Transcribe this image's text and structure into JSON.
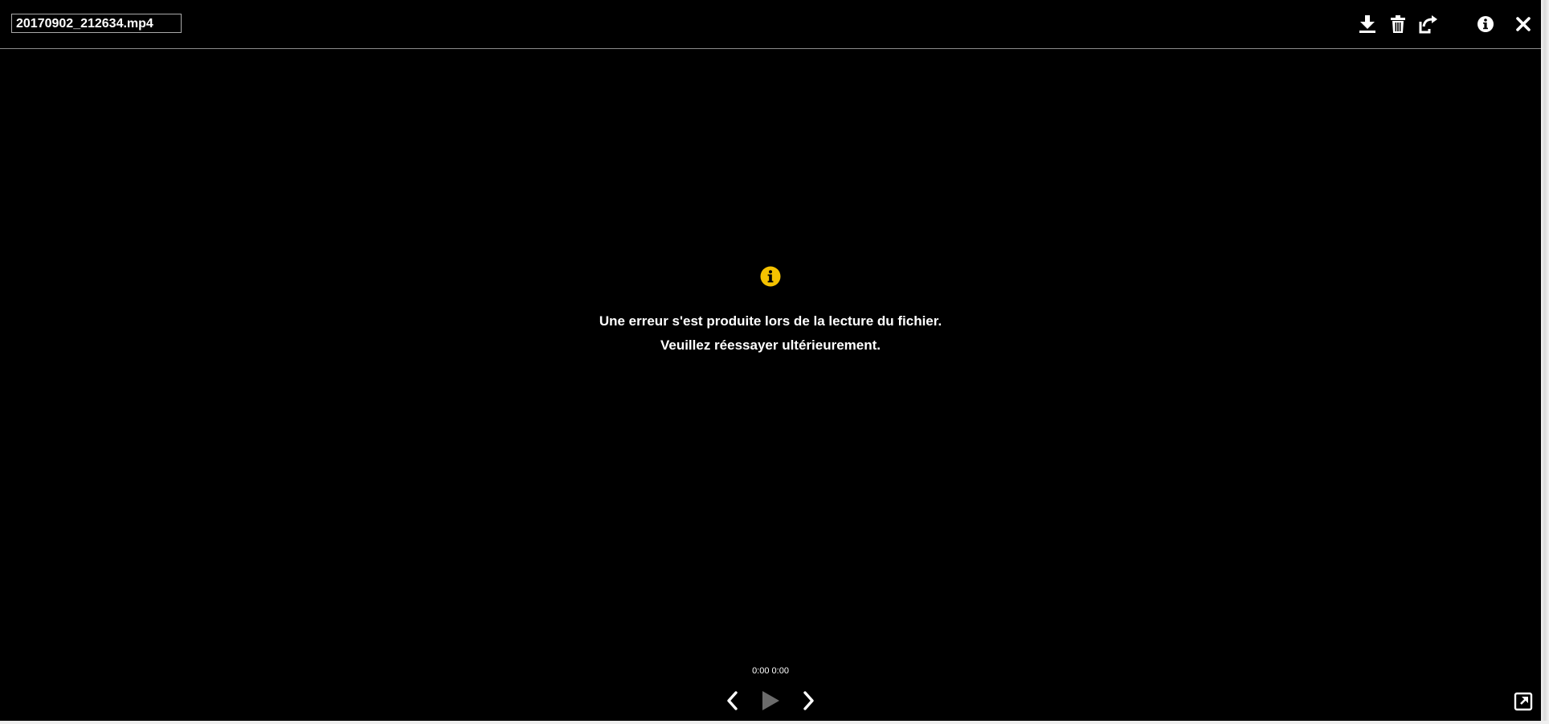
{
  "header": {
    "filename": "20170902_212634.mp4",
    "toolbar": {
      "download_icon": "download-icon",
      "delete_icon": "trash-icon",
      "share_icon": "share-icon",
      "info_icon": "info-icon",
      "close_icon": "close-icon"
    }
  },
  "message": {
    "icon": "info-circle-icon",
    "line1": "Une erreur s'est produite lors de la lecture du fichier.",
    "line2": "Veuillez réessayer ultérieurement."
  },
  "player": {
    "time": "0:00 0:00",
    "prev_icon": "chevron-left-icon",
    "play_icon": "play-icon",
    "next_icon": "chevron-right-icon",
    "popout_icon": "external-window-icon"
  },
  "colors": {
    "background": "#000000",
    "text": "#ffffff",
    "accent": "#f5c200",
    "disabled": "#6b6b6b",
    "divider": "#8c8c8c"
  }
}
